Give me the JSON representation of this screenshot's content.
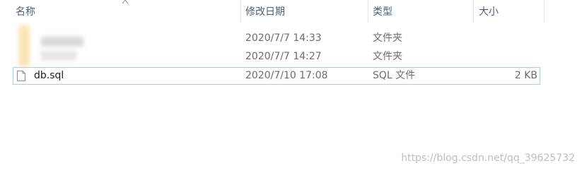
{
  "columns": {
    "name": "名称",
    "modified": "修改日期",
    "type": "类型",
    "size": "大小"
  },
  "rows": [
    {
      "name": "",
      "modified": "2020/7/7 14:33",
      "type": "文件夹",
      "size": "",
      "icon": "blurred-folder-icon"
    },
    {
      "name": "",
      "modified": "2020/7/7 14:27",
      "type": "文件夹",
      "size": "",
      "icon": "blurred-folder-icon"
    },
    {
      "name": "db.sql",
      "modified": "2020/7/10 17:08",
      "type": "SQL 文件",
      "size": "2 KB",
      "icon": "file-icon"
    }
  ],
  "watermark": "https://blog.csdn.net/qq_39625732",
  "colors": {
    "header_text": "#4c607a",
    "selection_border": "#99d1ff"
  }
}
